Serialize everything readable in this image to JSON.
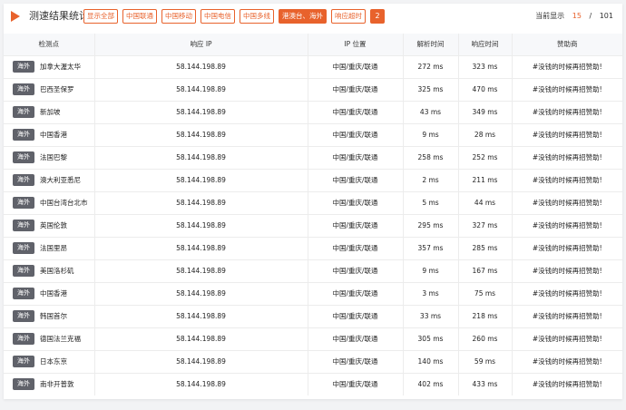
{
  "header": {
    "title": "测速结果统计",
    "filters": [
      {
        "label": "显示全部",
        "active": false
      },
      {
        "label": "中国联通",
        "active": false
      },
      {
        "label": "中国移动",
        "active": false
      },
      {
        "label": "中国电信",
        "active": false
      },
      {
        "label": "中国多线",
        "active": false
      },
      {
        "label": "港澳台、海外",
        "active": true
      },
      {
        "label": "响应超时",
        "active": false
      }
    ],
    "count_badge": "2",
    "pager": {
      "label": "当前显示",
      "current": "15",
      "separator": "/",
      "total": "101"
    }
  },
  "table": {
    "columns": [
      "检测点",
      "响应 IP",
      "IP 位置",
      "解析时间",
      "响应时间",
      "赞助商"
    ],
    "rows": [
      {
        "tag": "海外",
        "node": "加拿大渥太华",
        "ip": "58.144.198.89",
        "location": "中国/重庆/联通",
        "resolve": "272 ms",
        "response": "323 ms",
        "sponsor": "#没钱的时候再招赞助!"
      },
      {
        "tag": "海外",
        "node": "巴西圣保罗",
        "ip": "58.144.198.89",
        "location": "中国/重庆/联通",
        "resolve": "325 ms",
        "response": "470 ms",
        "sponsor": "#没钱的时候再招赞助!"
      },
      {
        "tag": "海外",
        "node": "新加坡",
        "ip": "58.144.198.89",
        "location": "中国/重庆/联通",
        "resolve": "43 ms",
        "response": "349 ms",
        "sponsor": "#没钱的时候再招赞助!"
      },
      {
        "tag": "海外",
        "node": "中国香港",
        "ip": "58.144.198.89",
        "location": "中国/重庆/联通",
        "resolve": "9 ms",
        "response": "28 ms",
        "sponsor": "#没钱的时候再招赞助!"
      },
      {
        "tag": "海外",
        "node": "法国巴黎",
        "ip": "58.144.198.89",
        "location": "中国/重庆/联通",
        "resolve": "258 ms",
        "response": "252 ms",
        "sponsor": "#没钱的时候再招赞助!"
      },
      {
        "tag": "海外",
        "node": "澳大利亚悉尼",
        "ip": "58.144.198.89",
        "location": "中国/重庆/联通",
        "resolve": "2 ms",
        "response": "211 ms",
        "sponsor": "#没钱的时候再招赞助!"
      },
      {
        "tag": "海外",
        "node": "中国台湾台北市",
        "ip": "58.144.198.89",
        "location": "中国/重庆/联通",
        "resolve": "5 ms",
        "response": "44 ms",
        "sponsor": "#没钱的时候再招赞助!"
      },
      {
        "tag": "海外",
        "node": "英国伦敦",
        "ip": "58.144.198.89",
        "location": "中国/重庆/联通",
        "resolve": "295 ms",
        "response": "327 ms",
        "sponsor": "#没钱的时候再招赞助!"
      },
      {
        "tag": "海外",
        "node": "法国里昂",
        "ip": "58.144.198.89",
        "location": "中国/重庆/联通",
        "resolve": "357 ms",
        "response": "285 ms",
        "sponsor": "#没钱的时候再招赞助!"
      },
      {
        "tag": "海外",
        "node": "美国洛杉矶",
        "ip": "58.144.198.89",
        "location": "中国/重庆/联通",
        "resolve": "9 ms",
        "response": "167 ms",
        "sponsor": "#没钱的时候再招赞助!"
      },
      {
        "tag": "海外",
        "node": "中国香港",
        "ip": "58.144.198.89",
        "location": "中国/重庆/联通",
        "resolve": "3 ms",
        "response": "75 ms",
        "sponsor": "#没钱的时候再招赞助!"
      },
      {
        "tag": "海外",
        "node": "韩国首尔",
        "ip": "58.144.198.89",
        "location": "中国/重庆/联通",
        "resolve": "33 ms",
        "response": "218 ms",
        "sponsor": "#没钱的时候再招赞助!"
      },
      {
        "tag": "海外",
        "node": "德国法兰克福",
        "ip": "58.144.198.89",
        "location": "中国/重庆/联通",
        "resolve": "305 ms",
        "response": "260 ms",
        "sponsor": "#没钱的时候再招赞助!"
      },
      {
        "tag": "海外",
        "node": "日本东京",
        "ip": "58.144.198.89",
        "location": "中国/重庆/联通",
        "resolve": "140 ms",
        "response": "59 ms",
        "sponsor": "#没钱的时候再招赞助!"
      },
      {
        "tag": "海外",
        "node": "南非开普敦",
        "ip": "58.144.198.89",
        "location": "中国/重庆/联通",
        "resolve": "402 ms",
        "response": "433 ms",
        "sponsor": "#没钱的时候再招赞助!"
      }
    ]
  },
  "colors": {
    "accent": "#e8622c",
    "tag_bg": "#60626a"
  },
  "icons": {
    "logo": "play-triangle-icon"
  }
}
